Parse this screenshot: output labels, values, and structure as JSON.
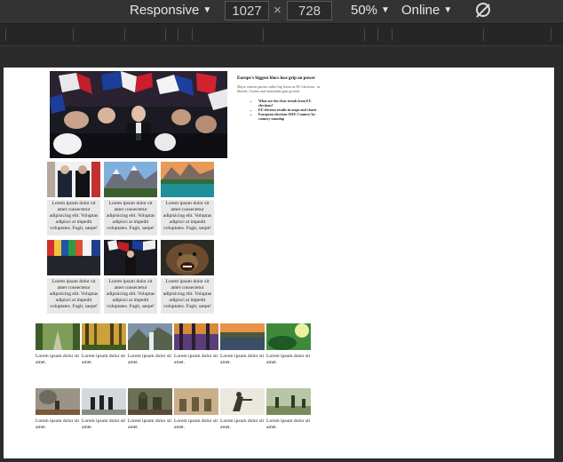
{
  "toolbar": {
    "device": "Responsive",
    "width": "1027",
    "times": "×",
    "height": "728",
    "zoom": "50%",
    "throttle": "Online"
  },
  "article": {
    "title": "Europe's biggest blocs lose grip on power",
    "summary": "Major centrist parties suffer big losses as EU elections , as liberals, Greens and nationalist gain ground",
    "links": [
      "What are the clear trends from EU elections?",
      "EU election results in maps and charts",
      "European elections 2019: Country-by-country roundup"
    ]
  },
  "grid_text": "Lorem ipsum dolor sit amet consectetur adipisicing elit. Voluptas adipisci at impedit voluptates. Fugit, saepe!",
  "strip_text": "Lorem ipsum dolor sit amet."
}
